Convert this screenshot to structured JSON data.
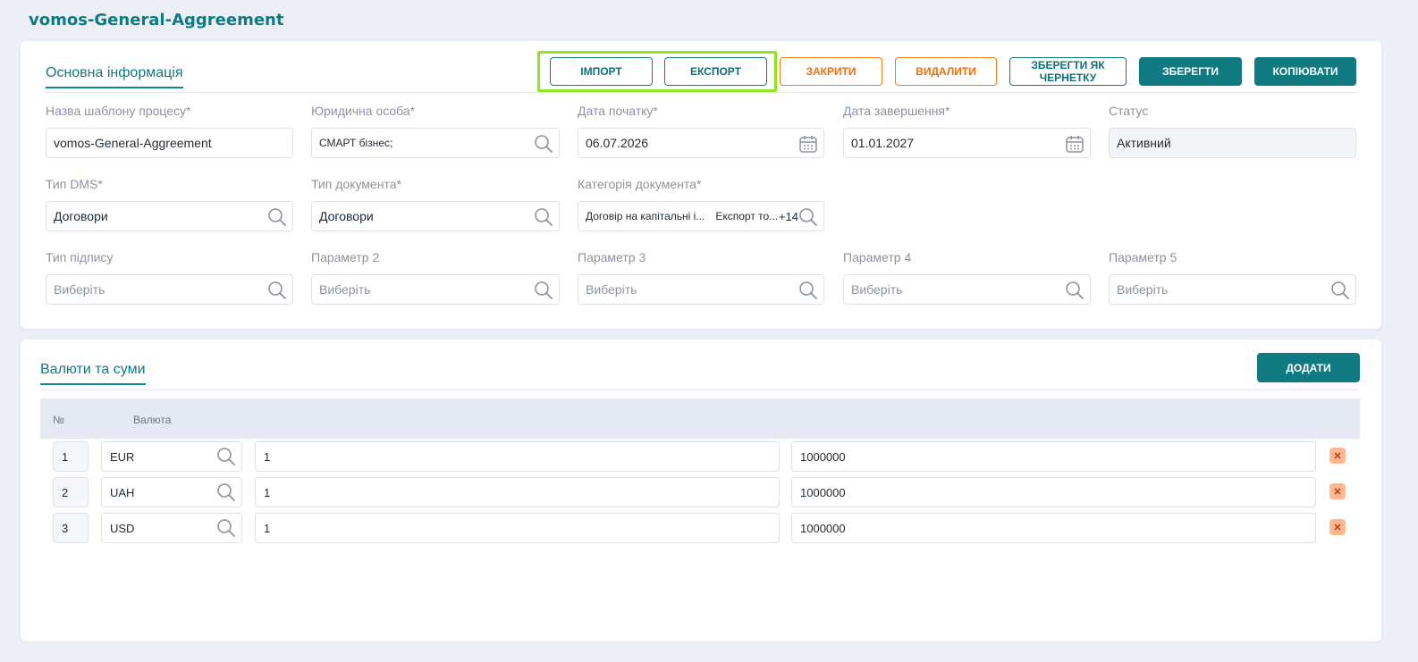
{
  "page": {
    "title": "vomos-General-Aggreement"
  },
  "main_info": {
    "tab_label": "Основна інформація",
    "buttons": {
      "import": "ІМПОРТ",
      "export": "ЕКСПОРТ",
      "close": "ЗАКРИТИ",
      "delete": "ВИДАЛИТИ",
      "save_draft": "ЗБЕРЕГТИ ЯК ЧЕРНЕТКУ",
      "save": "ЗБЕРЕГТИ",
      "copy": "КОПІЮВАТИ"
    },
    "fields": {
      "template_name": {
        "label": "Назва шаблону процесу*",
        "value": "vomos-General-Aggreement"
      },
      "legal_entity": {
        "label": "Юридична особа*",
        "value": "СМАРТ бізнес;"
      },
      "start_date": {
        "label": "Дата початку*",
        "value": "06.07.2026"
      },
      "end_date": {
        "label": "Дата завершення*",
        "value": "01.01.2027"
      },
      "status": {
        "label": "Статус",
        "value": "Активний"
      },
      "dms_type": {
        "label": "Тип DMS*",
        "value": "Договори"
      },
      "document_type": {
        "label": "Тип документа*",
        "value": "Договори"
      },
      "document_category": {
        "label": "Категорія документа*",
        "chips": [
          "Договір на капітальні і...",
          "Експорт то..."
        ],
        "more": "+14"
      },
      "signature_type": {
        "label": "Тип підпису",
        "placeholder": "Виберіть"
      },
      "param2": {
        "label": "Параметр 2",
        "placeholder": "Виберіть"
      },
      "param3": {
        "label": "Параметр 3",
        "placeholder": "Виберіть"
      },
      "param4": {
        "label": "Параметр 4",
        "placeholder": "Виберіть"
      },
      "param5": {
        "label": "Параметр 5",
        "placeholder": "Виберіть"
      }
    }
  },
  "currencies": {
    "tab_label": "Валюти та суми",
    "add_button": "ДОДАТИ",
    "columns": {
      "num": "№",
      "currency": "Валюта"
    },
    "rows": [
      {
        "num": "1",
        "currency": "EUR",
        "min": "1",
        "max": "1000000"
      },
      {
        "num": "2",
        "currency": "UAH",
        "min": "1",
        "max": "1000000"
      },
      {
        "num": "3",
        "currency": "USD",
        "min": "1",
        "max": "1000000"
      }
    ]
  },
  "colors": {
    "accent": "#0f7a80",
    "warning": "#ee6f0e",
    "highlight": "#8ee81c",
    "delete": "#ffb891"
  },
  "icons": [
    "search-icon",
    "calendar-icon",
    "close-icon"
  ]
}
